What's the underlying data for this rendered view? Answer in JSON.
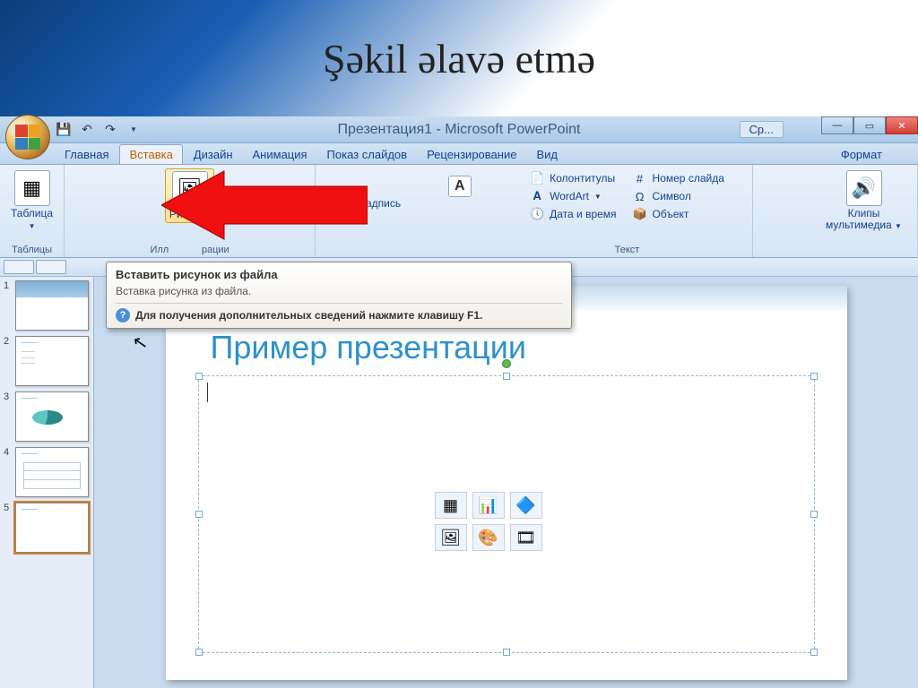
{
  "banner_title": "Şəkil əlavə etmə",
  "window_title": "Презентация1 - Microsoft PowerPoint",
  "help_tab": "Ср...",
  "tabs": {
    "home": "Главная",
    "insert": "Вставка",
    "design": "Дизайн",
    "animation": "Анимация",
    "slideshow": "Показ слайдов",
    "review": "Рецензирование",
    "view": "Вид",
    "format": "Формат"
  },
  "ribbon": {
    "tables": {
      "label": "Таблица",
      "group": "Таблицы"
    },
    "picture": {
      "label": "Рисунок"
    },
    "illustrations_group": "Иллюстрации",
    "textbox_partial": "адпись",
    "text_group": "Текст",
    "hdrftr": "Колонтитулы",
    "wordart": "WordArt",
    "datetime": "Дата и время",
    "slidenum": "Номер слайда",
    "symbol": "Символ",
    "object": "Объект",
    "media": {
      "label": "Клипы мультимедиа"
    }
  },
  "tooltip": {
    "title": "Вставить рисунок из файла",
    "body": "Вставка рисунка из файла.",
    "help": "Для получения дополнительных сведений нажмите клавишу F1."
  },
  "slide": {
    "title": "Пример презентации"
  },
  "thumbs": [
    "1",
    "2",
    "3",
    "4",
    "5"
  ]
}
